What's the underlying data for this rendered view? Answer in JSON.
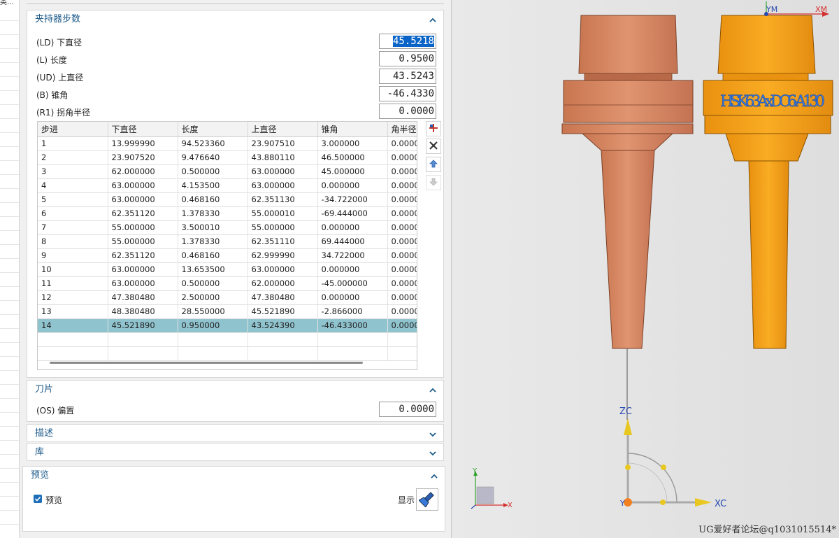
{
  "left_strip": {
    "partial_text": "类..."
  },
  "sections": {
    "holder_steps": {
      "title": "夹持器步数",
      "params": [
        {
          "label": "(LD) 下直径",
          "value": "45.5218"
        },
        {
          "label": "(L) 长度",
          "value": "0.9500"
        },
        {
          "label": "(UD) 上直径",
          "value": "43.5243"
        },
        {
          "label": "(B) 锥角",
          "value": "-46.4330"
        },
        {
          "label": "(R1) 拐角半径",
          "value": "0.0000"
        }
      ],
      "table": {
        "headers": [
          "步进",
          "下直径",
          "长度",
          "上直径",
          "锥角",
          "角半径"
        ],
        "rows": [
          [
            "1",
            "13.999990",
            "94.523360",
            "23.907510",
            "3.000000",
            "0.0000"
          ],
          [
            "2",
            "23.907520",
            "9.476640",
            "43.880110",
            "46.500000",
            "0.0000"
          ],
          [
            "3",
            "62.000000",
            "0.500000",
            "63.000000",
            "45.000000",
            "0.0000"
          ],
          [
            "4",
            "63.000000",
            "4.153500",
            "63.000000",
            "0.000000",
            "0.0000"
          ],
          [
            "5",
            "63.000000",
            "0.468160",
            "62.351130",
            "-34.722000",
            "0.0000"
          ],
          [
            "6",
            "62.351120",
            "1.378330",
            "55.000010",
            "-69.444000",
            "0.0000"
          ],
          [
            "7",
            "55.000000",
            "3.500010",
            "55.000000",
            "0.000000",
            "0.0000"
          ],
          [
            "8",
            "55.000000",
            "1.378330",
            "62.351110",
            "69.444000",
            "0.0000"
          ],
          [
            "9",
            "62.351120",
            "0.468160",
            "62.999990",
            "34.722000",
            "0.0000"
          ],
          [
            "10",
            "63.000000",
            "13.653500",
            "63.000000",
            "0.000000",
            "0.0000"
          ],
          [
            "11",
            "63.000000",
            "0.500000",
            "62.000000",
            "-45.000000",
            "0.0000"
          ],
          [
            "12",
            "47.380480",
            "2.500000",
            "47.380480",
            "0.000000",
            "0.0000"
          ],
          [
            "13",
            "48.380480",
            "28.550000",
            "45.521890",
            "-2.866000",
            "0.0000"
          ],
          [
            "14",
            "45.521890",
            "0.950000",
            "43.524390",
            "-46.433000",
            "0.0000"
          ]
        ],
        "selected_row": 14
      }
    },
    "insert": {
      "title": "刀片",
      "offset_label": "(OS) 偏置",
      "offset_value": "0.0000"
    },
    "description": {
      "title": "描述"
    },
    "library": {
      "title": "库"
    },
    "preview": {
      "title": "预览",
      "checkbox_label": "预览",
      "checked": true,
      "show_label": "显示"
    }
  },
  "viewport": {
    "labels": {
      "zc": "ZC",
      "xc": "XC",
      "ym": "YM",
      "xm": "XM",
      "y_small": "Y",
      "x_small": "X",
      "y_origin": "Y"
    },
    "tool_text": "HSK63AxDC6-A130",
    "watermark": "UG爱好者论坛@q1031015514*"
  },
  "colors": {
    "header_text": "#1c5a8a",
    "selection": "#0a64c8",
    "selected_row": "#8fc3ce",
    "holder_copper": "#d98a62",
    "holder_orange": "#f6a31c",
    "tool_text": "#3a7ad8",
    "axis_z": "#e8c820",
    "axis_red": "#d43030"
  }
}
